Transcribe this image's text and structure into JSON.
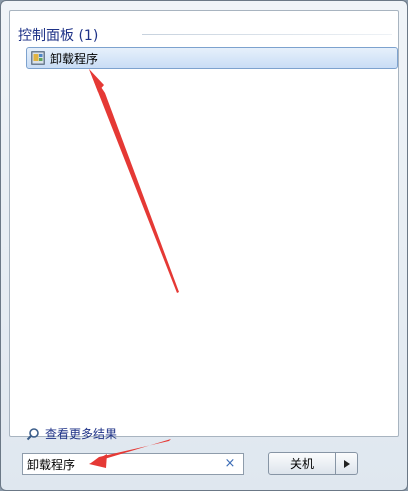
{
  "results": {
    "group_header": "控制面板 (1)",
    "items": [
      {
        "label": "卸载程序",
        "icon": "programs-icon"
      }
    ],
    "see_more": "查看更多结果"
  },
  "search": {
    "value": "卸载程序",
    "clear_symbol": "×"
  },
  "shutdown": {
    "label": "关机"
  },
  "colors": {
    "accent": "#1e3287",
    "highlight_border": "#7da2ce",
    "annotation_arrow": "#e53935"
  }
}
